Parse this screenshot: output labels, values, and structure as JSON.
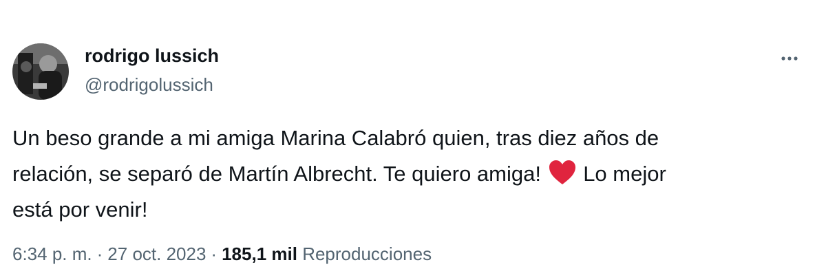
{
  "author": {
    "display_name": "rodrigo lussich",
    "handle": "@rodrigolussich",
    "avatar_icon": "profile-photo"
  },
  "more_icon": "ellipsis-icon",
  "tweet": {
    "text_before_emoji": "Un beso grande a mi amiga Marina Calabró quien, tras diez años de\nrelación, se separó de Martín Albrecht. Te quiero amiga! ",
    "emoji": "red-heart-icon",
    "text_after_emoji": " Lo mejor\nestá por venir!"
  },
  "meta": {
    "time": "6:34 p. m.",
    "separator": "·",
    "date": "27 oct. 2023",
    "views_count": "185,1 mil",
    "views_label": "Reproducciones"
  },
  "colors": {
    "text": "#0f1419",
    "secondary": "#536471",
    "heart": "#e0243e"
  }
}
